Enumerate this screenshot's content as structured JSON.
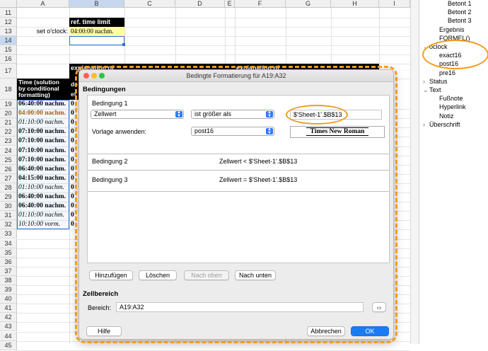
{
  "sheet": {
    "columns": [
      "A",
      "B",
      "C",
      "D",
      "E",
      "F",
      "G",
      "H",
      "I"
    ],
    "rows": [
      "11",
      "12",
      "13",
      "14",
      "15",
      "16",
      "17",
      "18",
      "19",
      "20",
      "21",
      "22",
      "23",
      "24",
      "25",
      "26",
      "27",
      "28",
      "29",
      "30",
      "31",
      "32",
      "33",
      "34",
      "35",
      "36",
      "37",
      "38",
      "39",
      "40",
      "41",
      "42",
      "43",
      "44",
      "45"
    ],
    "ref_time_label": "ref. time limit",
    "set_oclock_label": "set o'clock:",
    "set_oclock_value": "04:00:00 nachm.",
    "time_header": "Time (solution by conditional formatting)",
    "explanation_b": "explanation of",
    "explanation_f": "explanation of",
    "b_header_fragment": "de",
    "b_header_fragment2": "ef",
    "times": [
      {
        "value": "06:40:00 nachm.",
        "style": "bold"
      },
      {
        "value": "04:00:00 nachm.",
        "style": "brown"
      },
      {
        "value": "01:10:00 nachm.",
        "style": "italic"
      },
      {
        "value": "07:10:00 nachm.",
        "style": "bold"
      },
      {
        "value": "07:10:00 nachm.",
        "style": "bold"
      },
      {
        "value": "07:10:00 nachm.",
        "style": "bold"
      },
      {
        "value": "07:10:00 nachm.",
        "style": "bold"
      },
      {
        "value": "06:40:00 nachm.",
        "style": "bold"
      },
      {
        "value": "04:15:00 nachm.",
        "style": "bold"
      },
      {
        "value": "01:10:00 nachm.",
        "style": "italic"
      },
      {
        "value": "06:40:00 nachm.",
        "style": "bold"
      },
      {
        "value": "06:40:00 nachm.",
        "style": "bold"
      },
      {
        "value": "01:10:00 nachm.",
        "style": "italic"
      },
      {
        "value": "10:10:00 vorm.",
        "style": "italic"
      }
    ],
    "b_col_glyph": "0"
  },
  "navigator": {
    "items": [
      {
        "label": "Betont 1",
        "level": 3
      },
      {
        "label": "Betont 2",
        "level": 3
      },
      {
        "label": "Betont 3",
        "level": 3
      },
      {
        "label": "Ergebnis",
        "level": 2
      },
      {
        "label": "FORMEL()",
        "level": 2
      },
      {
        "label": "oclock",
        "level": 1,
        "expanded": true
      },
      {
        "label": "exact16",
        "level": 2
      },
      {
        "label": "post16",
        "level": 2
      },
      {
        "label": "pre16",
        "level": 2
      },
      {
        "label": "Status",
        "level": 1
      },
      {
        "label": "Text",
        "level": 1,
        "expanded": true
      },
      {
        "label": "Fußnote",
        "level": 2
      },
      {
        "label": "Hyperlink",
        "level": 2
      },
      {
        "label": "Notiz",
        "level": 2
      },
      {
        "label": "Überschrift",
        "level": 1
      }
    ]
  },
  "dialog": {
    "title": "Bedingte Formatierung für A19:A32",
    "conditions_section": "Bedingungen",
    "condition1_label": "Bedingung 1",
    "cell_value_select": "Zellwert",
    "operator_select": "ist größer als",
    "value_field": "$'Sheet-1'.$B$13",
    "apply_style_label": "Vorlage anwenden:",
    "style_select": "post16",
    "preview_text": "Times New Roman",
    "condition2_label": "Bedingung 2",
    "condition2_text": "Zellwert < $'Sheet-1'.$B$13",
    "condition3_label": "Bedingung 3",
    "condition3_text": "Zellwert = $'Sheet-1'.$B$13",
    "btn_add": "Hinzufügen",
    "btn_delete": "Löschen",
    "btn_up": "Nach oben",
    "btn_down": "Nach unten",
    "range_section": "Zellbereich",
    "range_label": "Bereich:",
    "range_value": "A19:A32",
    "btn_help": "Hilfe",
    "btn_cancel": "Abbrechen",
    "btn_ok": "OK"
  },
  "colors": {
    "highlight": "#f39a1e",
    "accent": "#1a7cf5",
    "brown_text": "#b05a00",
    "ref_cell_bg": "#ffff99"
  }
}
